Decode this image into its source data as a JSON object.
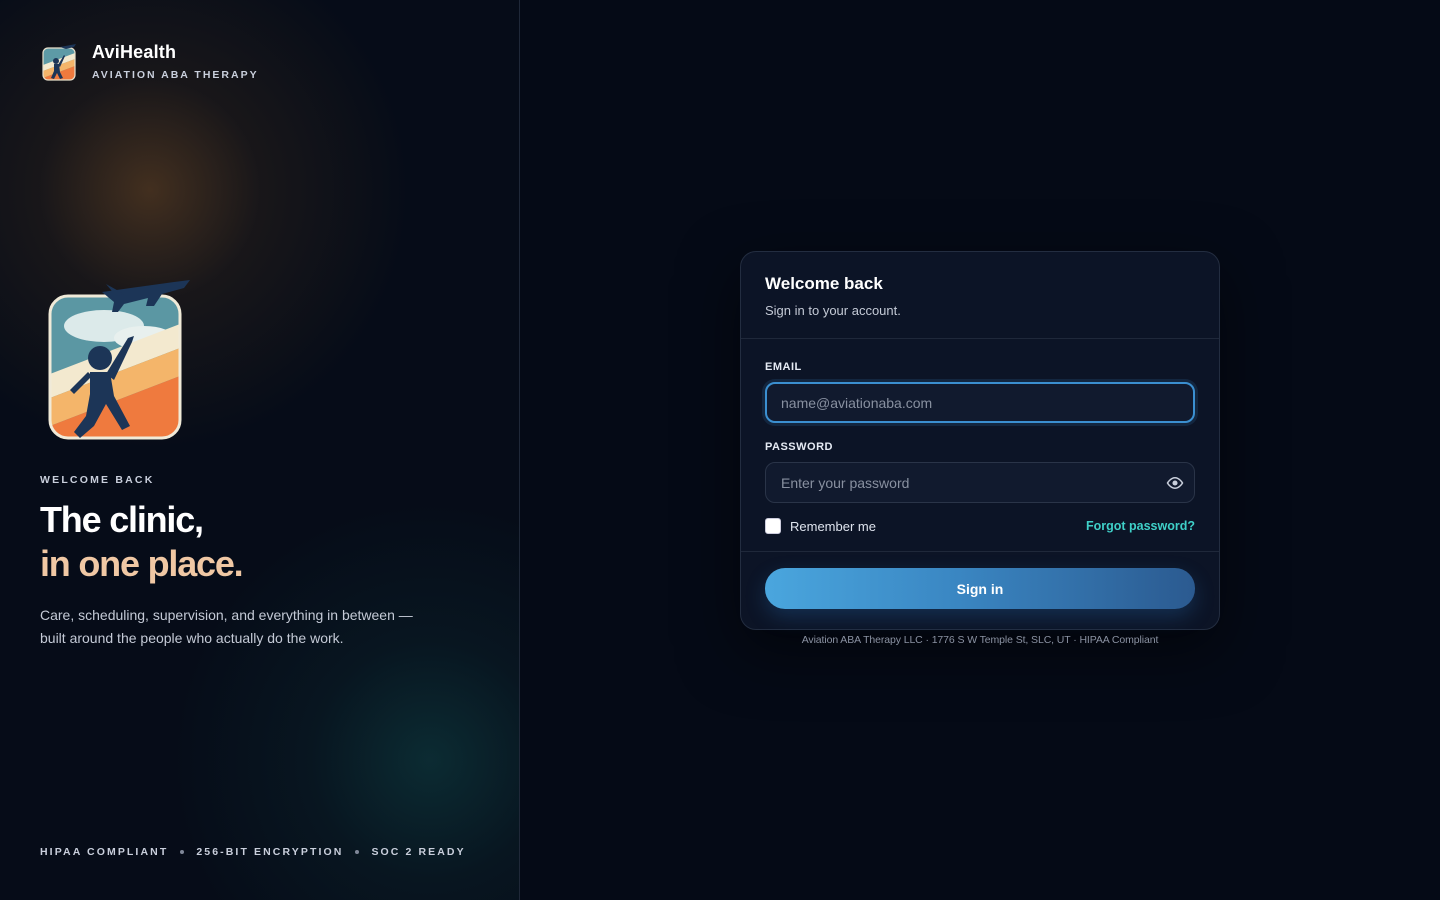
{
  "brand": {
    "name": "AviHealth",
    "subtitle": "AVIATION ABA THERAPY",
    "logo_icon": "child-airplane-logo-icon"
  },
  "hero": {
    "eyebrow": "WELCOME BACK",
    "headline_line1": "The clinic,",
    "headline_accent": "in one place.",
    "description": "Care, scheduling, supervision, and everything in between — built around the people who actually do the work."
  },
  "badges": [
    "HIPAA COMPLIANT",
    "256-BIT ENCRYPTION",
    "SOC 2 READY"
  ],
  "colors": {
    "accent_peach": "#f0c8a4",
    "link_teal": "#3fd0c8",
    "button_blue": "#4aa6de",
    "focus_blue": "#3b8fd0"
  },
  "card": {
    "title": "Welcome back",
    "subtitle": "Sign in to your account.",
    "email_label": "EMAIL",
    "email_placeholder": "name@aviationaba.com",
    "email_value": "",
    "password_label": "PASSWORD",
    "password_placeholder": "Enter your password",
    "password_value": "",
    "password_toggle_icon": "eye-icon",
    "remember_label": "Remember me",
    "remember_checked": false,
    "forgot_label": "Forgot password?",
    "signin_label": "Sign in"
  },
  "footer": "Aviation ABA Therapy LLC · 1776 S W Temple St, SLC, UT · HIPAA Compliant"
}
